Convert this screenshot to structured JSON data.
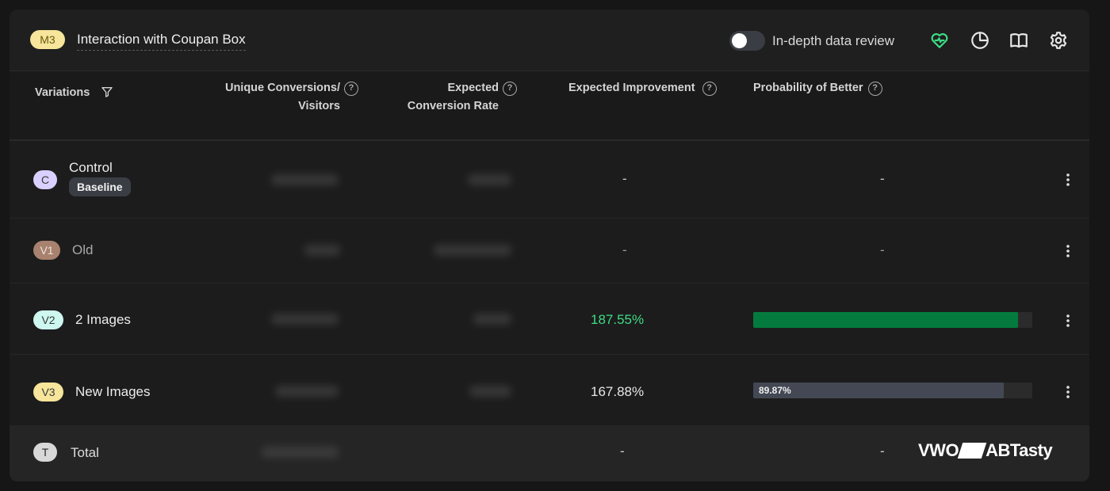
{
  "header": {
    "metric_badge": "M3",
    "metric_title": "Interaction with Coupan Box",
    "toggle_label": "In-depth data review",
    "toggle_on": false,
    "icons": [
      "heart-pulse-icon",
      "pie-chart-icon",
      "book-icon",
      "settings-icon"
    ],
    "accent_color": "#3ddc84"
  },
  "table": {
    "headers": {
      "variations": "Variations",
      "unique_conversions_l1": "Unique Conversions/",
      "unique_conversions_l2": "Visitors",
      "expected_rate_l1": "Expected",
      "expected_rate_l2": "Conversion Rate",
      "expected_improvement": "Expected Improvement",
      "probability_of_better": "Probability of Better",
      "help_glyph": "?"
    },
    "rows": [
      {
        "badge": "C",
        "badge_color": "#d9d0ff",
        "name": "Control",
        "tag": "Baseline",
        "improvement": "-",
        "probability_text": "-"
      },
      {
        "badge": "V1",
        "badge_color": "#a8826e",
        "name": "Old",
        "improvement": "-",
        "probability_text": "-"
      },
      {
        "badge": "V2",
        "badge_color": "#cdf7ef",
        "name": "2 Images",
        "improvement": "187.55%",
        "improvement_color": "#3ddc84",
        "probability": 0.95,
        "probability_color": "#047a3f"
      },
      {
        "badge": "V3",
        "badge_color": "#f6e59a",
        "name": "New Images",
        "improvement": "167.88%",
        "improvement_color": "#e6e6e6",
        "probability": 0.8987,
        "probability_label": "89.87%",
        "probability_color": "#434854"
      }
    ],
    "total": {
      "badge": "T",
      "name": "Total",
      "improvement": "-",
      "probability_text": "-"
    }
  },
  "watermark": {
    "left": "VWO",
    "right": "ABTasty"
  }
}
